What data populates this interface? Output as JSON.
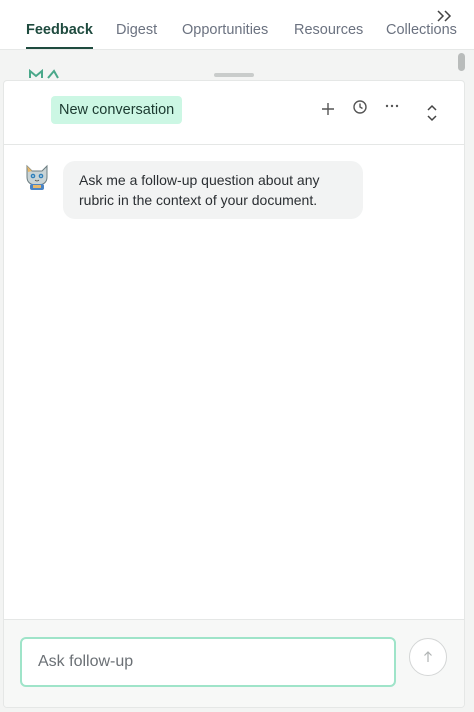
{
  "tabs": [
    {
      "label": "Feedback",
      "active": true
    },
    {
      "label": "Digest"
    },
    {
      "label": "Opportunities"
    },
    {
      "label": "Resources"
    },
    {
      "label": "Collections"
    }
  ],
  "collapse_icon": "double-chevron-right-icon",
  "header": {
    "new_conversation_label": "New conversation",
    "icons": [
      "plus-icon",
      "history-clock-icon",
      "more-horizontal-icon",
      "expand-collapse-icon"
    ]
  },
  "messages": [
    {
      "role": "assistant",
      "avatar": "cat-avatar",
      "text": "Ask me a follow-up question about any rubric in the context of your document."
    }
  ],
  "composer": {
    "placeholder": "Ask follow-up",
    "value": "",
    "send_icon": "arrow-up-icon"
  },
  "colors": {
    "accent": "#1f4b3f",
    "badge_bg": "#ccf7e4",
    "input_border": "#9fe4c9"
  }
}
